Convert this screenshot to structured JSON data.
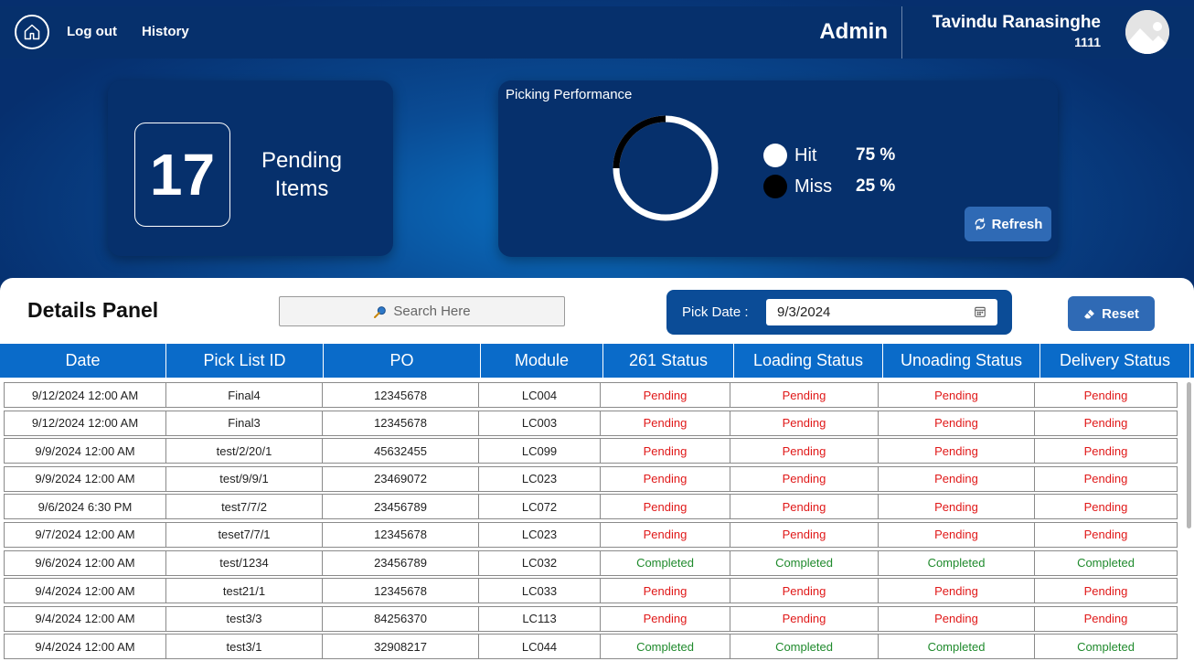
{
  "header": {
    "nav": {
      "logout": "Log out",
      "history": "History"
    },
    "role": "Admin",
    "user": {
      "name": "Tavindu Ranasinghe",
      "id": "1111"
    }
  },
  "pending": {
    "count": "17",
    "label": "Pending Items"
  },
  "performance": {
    "title": "Picking Performance",
    "hit": {
      "label": "Hit",
      "value": "75 %",
      "fraction": 0.75
    },
    "miss": {
      "label": "Miss",
      "value": "25 %",
      "fraction": 0.25
    },
    "refresh_label": "Refresh"
  },
  "details": {
    "title": "Details Panel",
    "search_placeholder": "Search Here",
    "pick_date_label": "Pick Date :",
    "pick_date_value": "9/3/2024",
    "reset_label": "Reset"
  },
  "table": {
    "columns": [
      "Date",
      "Pick List ID",
      "PO",
      "Module",
      "261 Status",
      "Loading Status",
      "Unoading Status",
      "Delivery Status"
    ],
    "rows": [
      [
        "9/12/2024 12:00 AM",
        "Final4",
        "12345678",
        "LC004",
        "Pending",
        "Pending",
        "Pending",
        "Pending"
      ],
      [
        "9/12/2024 12:00 AM",
        "Final3",
        "12345678",
        "LC003",
        "Pending",
        "Pending",
        "Pending",
        "Pending"
      ],
      [
        "9/9/2024 12:00 AM",
        "test/2/20/1",
        "45632455",
        "LC099",
        "Pending",
        "Pending",
        "Pending",
        "Pending"
      ],
      [
        "9/9/2024 12:00 AM",
        "test/9/9/1",
        "23469072",
        "LC023",
        "Pending",
        "Pending",
        "Pending",
        "Pending"
      ],
      [
        "9/6/2024 6:30 PM",
        "test7/7/2",
        "23456789",
        "LC072",
        "Pending",
        "Pending",
        "Pending",
        "Pending"
      ],
      [
        "9/7/2024 12:00 AM",
        "teset7/7/1",
        "12345678",
        "LC023",
        "Pending",
        "Pending",
        "Pending",
        "Pending"
      ],
      [
        "9/6/2024 12:00 AM",
        "test/1234",
        "23456789",
        "LC032",
        "Completed",
        "Completed",
        "Completed",
        "Completed"
      ],
      [
        "9/4/2024 12:00 AM",
        "test21/1",
        "12345678",
        "LC033",
        "Pending",
        "Pending",
        "Pending",
        "Pending"
      ],
      [
        "9/4/2024 12:00 AM",
        "test3/3",
        "84256370",
        "LC113",
        "Pending",
        "Pending",
        "Pending",
        "Pending"
      ],
      [
        "9/4/2024 12:00 AM",
        "test3/1",
        "32908217",
        "LC044",
        "Completed",
        "Completed",
        "Completed",
        "Completed"
      ]
    ]
  },
  "colors": {
    "pending": "#e01818",
    "completed": "#1f8a2c",
    "accent": "#0a6bc9",
    "header_bg": "#06306c"
  },
  "icons": {
    "home": "home-icon",
    "avatar": "image-placeholder-icon",
    "refresh": "refresh-icon",
    "search": "search-icon",
    "calendar": "calendar-icon",
    "reset": "eraser-icon"
  }
}
